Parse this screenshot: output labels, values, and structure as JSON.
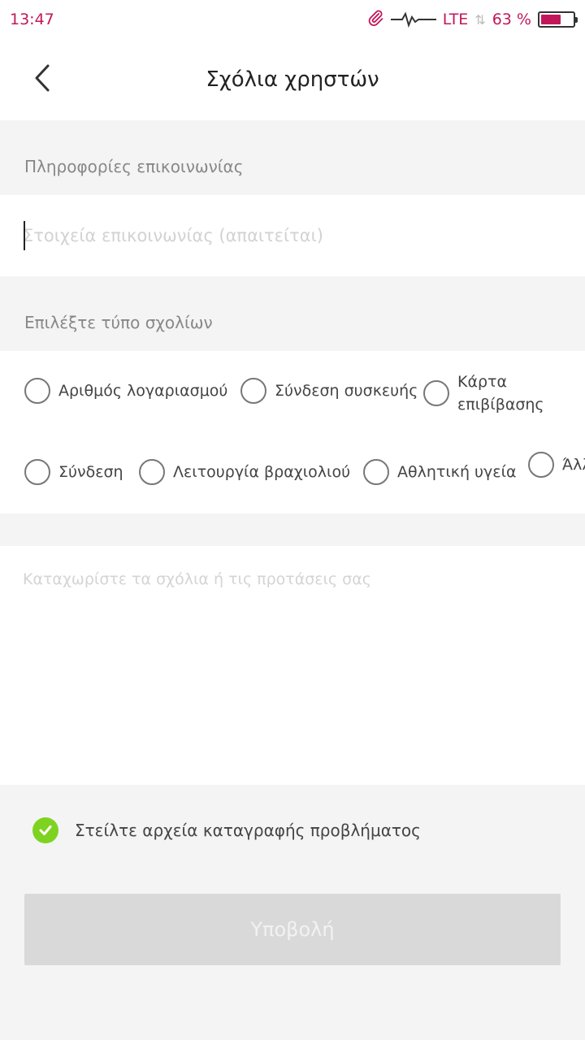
{
  "status_bar": {
    "time": "13:47",
    "network": "LTE",
    "battery_text": "63 %",
    "battery_level": 0.63,
    "accent_color": "#c2185b",
    "icons": [
      "attachment-icon",
      "pulse-icon",
      "data-arrows-icon",
      "battery-icon"
    ]
  },
  "header": {
    "title": "Σχόλια χρηστών",
    "back_icon": "chevron-left-icon"
  },
  "contact": {
    "section_label": "Πληροφορίες επικοινωνίας",
    "placeholder": "Στοιχεία επικοινωνίας (απαιτείται)",
    "value": ""
  },
  "feedback_types": {
    "section_label": "Επιλέξτε τύπο σχολίων",
    "options": [
      {
        "label": "Αριθμός λογαριασμού",
        "selected": false
      },
      {
        "label": "Σύνδεση συσκευής",
        "selected": false
      },
      {
        "label": "Κάρτα επιβίβασης",
        "selected": false
      },
      {
        "label": "Σύνδεση",
        "selected": false
      },
      {
        "label": "Λειτουργία βραχιολιού",
        "selected": false
      },
      {
        "label": "Αθλητική υγεία",
        "selected": false
      },
      {
        "label": "Άλλα",
        "selected": false
      }
    ]
  },
  "feedback": {
    "placeholder": "Καταχωρίστε τα σχόλια ή τις προτάσεις σας",
    "value": ""
  },
  "send_logs": {
    "label": "Στείλτε αρχεία καταγραφής προβλήματος",
    "checked": true,
    "check_color": "#7ed321"
  },
  "submit": {
    "label": "Υποβολή",
    "enabled": false
  }
}
